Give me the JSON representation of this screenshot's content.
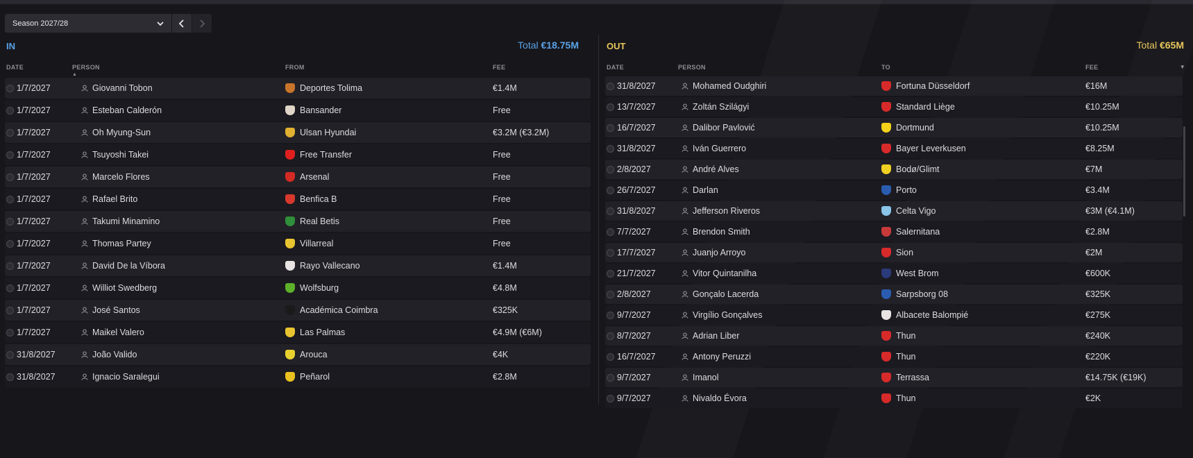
{
  "season": {
    "label": "Season 2027/28"
  },
  "in": {
    "title": "IN",
    "total_label": "Total ",
    "total_value": "€18.75M",
    "headers": {
      "date": "DATE",
      "person": "PERSON",
      "from": "FROM",
      "fee": "FEE"
    },
    "rows": [
      {
        "date": "1/7/2027",
        "person": "Giovanni Tobon",
        "club": "Deportes Tolima",
        "fee": "€1.4M",
        "badge": "#c8742a"
      },
      {
        "date": "1/7/2027",
        "person": "Esteban Calderón",
        "club": "Bansander",
        "fee": "Free",
        "badge": "#e0d6c8"
      },
      {
        "date": "1/7/2027",
        "person": "Oh Myung-Sun",
        "club": "Ulsan Hyundai",
        "fee": "€3.2M (€3.2M)",
        "badge": "#e0b030"
      },
      {
        "date": "1/7/2027",
        "person": "Tsuyoshi Takei",
        "club": "Free Transfer",
        "fee": "Free",
        "badge": "#e0201e"
      },
      {
        "date": "1/7/2027",
        "person": "Marcelo Flores",
        "club": "Arsenal",
        "fee": "Free",
        "badge": "#d42a24"
      },
      {
        "date": "1/7/2027",
        "person": "Rafael Brito",
        "club": "Benfica B",
        "fee": "Free",
        "badge": "#d8382c"
      },
      {
        "date": "1/7/2027",
        "person": "Takumi Minamino",
        "club": "Real Betis",
        "fee": "Free",
        "badge": "#2f8f3a"
      },
      {
        "date": "1/7/2027",
        "person": "Thomas Partey",
        "club": "Villarreal",
        "fee": "Free",
        "badge": "#e8c430"
      },
      {
        "date": "1/7/2027",
        "person": "David De la Víbora",
        "club": "Rayo Vallecano",
        "fee": "€1.4M",
        "badge": "#e8e4e4"
      },
      {
        "date": "1/7/2027",
        "person": "Williot Swedberg",
        "club": "Wolfsburg",
        "fee": "€4.8M",
        "badge": "#5cb02a"
      },
      {
        "date": "1/7/2027",
        "person": "José Santos",
        "club": "Académica Coimbra",
        "fee": "€325K",
        "badge": "#1a1a1a"
      },
      {
        "date": "1/7/2027",
        "person": "Maikel Valero",
        "club": "Las Palmas",
        "fee": "€4.9M (€6M)",
        "badge": "#e8c430"
      },
      {
        "date": "31/8/2027",
        "person": "João Valido",
        "club": "Arouca",
        "fee": "€4K",
        "badge": "#e8d030"
      },
      {
        "date": "31/8/2027",
        "person": "Ignacio Saralegui",
        "club": "Peñarol",
        "fee": "€2.8M",
        "badge": "#e8c020"
      }
    ]
  },
  "out": {
    "title": "OUT",
    "total_label": "Total ",
    "total_value": "€65M",
    "headers": {
      "date": "DATE",
      "person": "PERSON",
      "to": "TO",
      "fee": "FEE"
    },
    "rows": [
      {
        "date": "31/8/2027",
        "person": "Mohamed Oudghiri",
        "club": "Fortuna Düsseldorf",
        "fee": "€16M",
        "badge": "#d82a2a"
      },
      {
        "date": "13/7/2027",
        "person": "Zoltán Szilágyi",
        "club": "Standard Liège",
        "fee": "€10.25M",
        "badge": "#d82a2a"
      },
      {
        "date": "16/7/2027",
        "person": "Dalibor Pavlović",
        "club": "Dortmund",
        "fee": "€10.25M",
        "badge": "#f4d21a"
      },
      {
        "date": "31/8/2027",
        "person": "Iván Guerrero",
        "club": "Bayer Leverkusen",
        "fee": "€8.25M",
        "badge": "#d82a2a"
      },
      {
        "date": "2/8/2027",
        "person": "André Alves",
        "club": "Bodø/Glimt",
        "fee": "€7M",
        "badge": "#f0d020"
      },
      {
        "date": "26/7/2027",
        "person": "Darlan",
        "club": "Porto",
        "fee": "€3.4M",
        "badge": "#2a5cb0"
      },
      {
        "date": "31/8/2027",
        "person": "Jefferson Riveros",
        "club": "Celta Vigo",
        "fee": "€3M (€4.1M)",
        "badge": "#8ac4e8"
      },
      {
        "date": "7/7/2027",
        "person": "Brendon Smith",
        "club": "Salernitana",
        "fee": "€2.8M",
        "badge": "#c83a3a"
      },
      {
        "date": "17/7/2027",
        "person": "Juanjo Arroyo",
        "club": "Sion",
        "fee": "€2M",
        "badge": "#d82a2a"
      },
      {
        "date": "21/7/2027",
        "person": "Vitor Quintanilha",
        "club": "West Brom",
        "fee": "€600K",
        "badge": "#2a3a7a"
      },
      {
        "date": "2/8/2027",
        "person": "Gonçalo Lacerda",
        "club": "Sarpsborg 08",
        "fee": "€325K",
        "badge": "#2a5cb0"
      },
      {
        "date": "9/7/2027",
        "person": "Virgílio Gonçalves",
        "club": "Albacete Balompié",
        "fee": "€275K",
        "badge": "#e8e4e4"
      },
      {
        "date": "8/7/2027",
        "person": "Adrian Liber",
        "club": "Thun",
        "fee": "€240K",
        "badge": "#d82a2a"
      },
      {
        "date": "16/7/2027",
        "person": "Antony Peruzzi",
        "club": "Thun",
        "fee": "€220K",
        "badge": "#d82a2a"
      },
      {
        "date": "9/7/2027",
        "person": "Imanol",
        "club": "Terrassa",
        "fee": "€14.75K (€19K)",
        "badge": "#d82a2a"
      },
      {
        "date": "9/7/2027",
        "person": "Nivaldo Évora",
        "club": "Thun",
        "fee": "€2K",
        "badge": "#d82a2a"
      }
    ]
  }
}
